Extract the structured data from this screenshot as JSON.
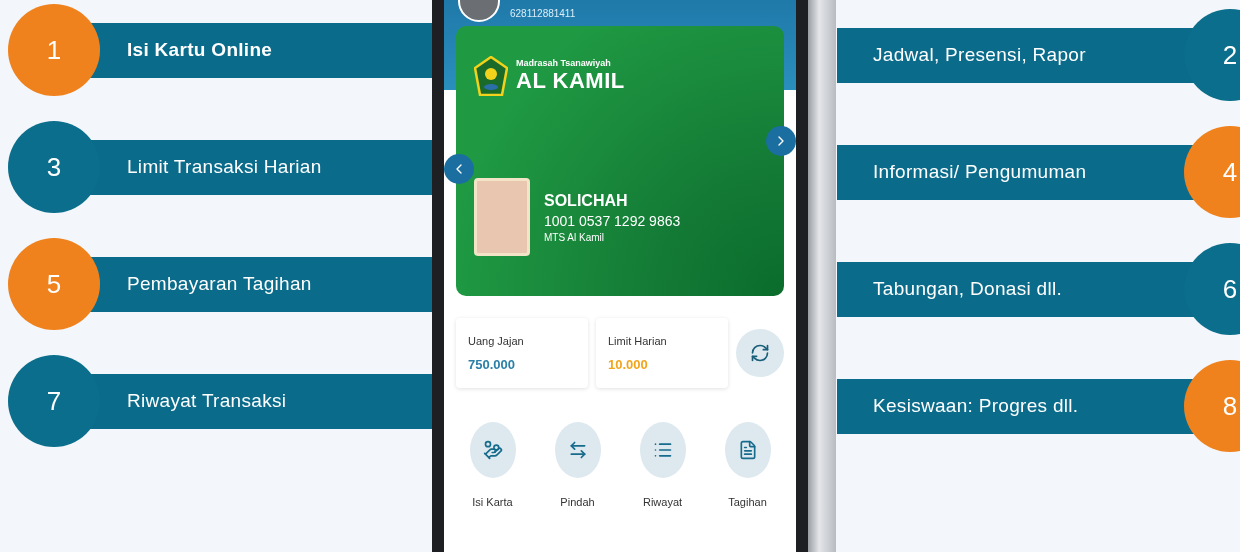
{
  "callouts_left": [
    {
      "number": "1",
      "label": "Isi Kartu Online",
      "color": "#f0821e",
      "bold": true
    },
    {
      "number": "3",
      "label": "Limit Transaksi Harian",
      "color": "#0b6e8c",
      "bold": false
    },
    {
      "number": "5",
      "label": "Pembayaran Tagihan",
      "color": "#f0821e",
      "bold": false
    },
    {
      "number": "7",
      "label": "Riwayat Transaksi",
      "color": "#0b6e8c",
      "bold": false
    }
  ],
  "callouts_right": [
    {
      "number": "2",
      "label": "Jadwal, Presensi, Rapor",
      "color": "#0b6e8c",
      "bold": false
    },
    {
      "number": "4",
      "label": "Informasi/ Pengumuman",
      "color": "#f0821e",
      "bold": false
    },
    {
      "number": "6",
      "label": "Tabungan, Donasi dll.",
      "color": "#0b6e8c",
      "bold": false
    },
    {
      "number": "8",
      "label": "Kesiswaan: Progres dll.",
      "color": "#f0821e",
      "bold": false
    }
  ],
  "phone": {
    "header": {
      "account_number": "628112881411"
    },
    "card": {
      "school_prefix": "Madrasah Tsanawiyah",
      "school_name": "AL KAMIL",
      "student_name": "SOLICHAH",
      "card_number": "1001 0537 1292 9863",
      "school": "MTS Al Kamil"
    },
    "balances": [
      {
        "label": "Uang Jajan",
        "value": "750.000",
        "color": "#2a7fa8"
      },
      {
        "label": "Limit Harian",
        "value": "10.000",
        "color": "#f2a51c"
      }
    ],
    "menu": [
      {
        "kind": "topup",
        "label": "Isi Karta"
      },
      {
        "kind": "transfer",
        "label": "Pindah"
      },
      {
        "kind": "history",
        "label": "Riwayat"
      },
      {
        "kind": "bill",
        "label": "Tagihan"
      }
    ]
  }
}
